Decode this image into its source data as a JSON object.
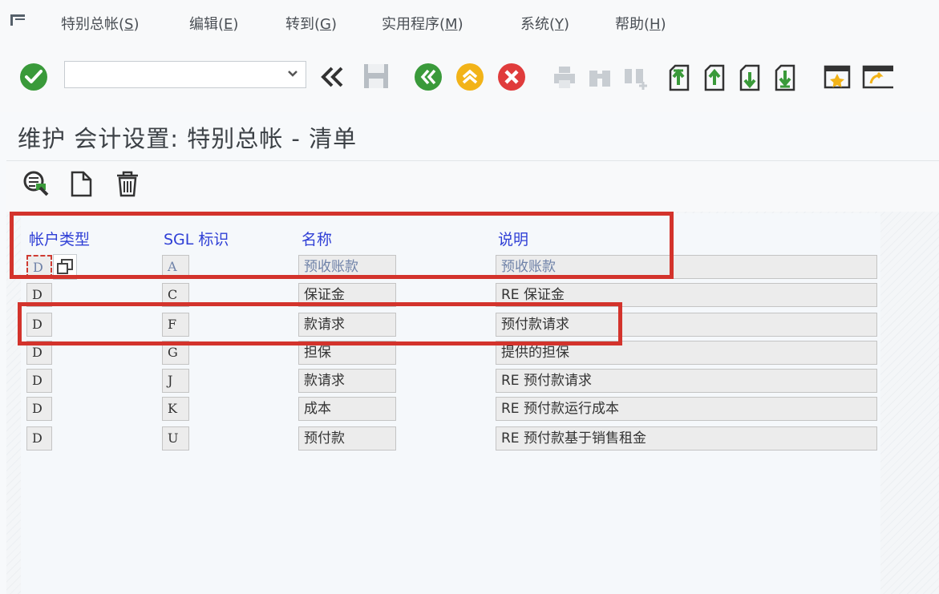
{
  "menu": {
    "items": [
      {
        "label": "特别总帐(",
        "key": "S",
        "tail": ")"
      },
      {
        "label": "编辑(",
        "key": "E",
        "tail": ")"
      },
      {
        "label": "转到(",
        "key": "G",
        "tail": ")"
      },
      {
        "label": "实用程序(",
        "key": "M",
        "tail": ")"
      },
      {
        "label": "系统(",
        "key": "Y",
        "tail": ")"
      },
      {
        "label": "帮助(",
        "key": "H",
        "tail": ")"
      }
    ]
  },
  "toolbar": {
    "command_value": ""
  },
  "title": "维护 会计设置: 特别总帐 - 清单",
  "table": {
    "headers": [
      "帐户类型",
      "SGL 标识",
      "名称",
      "说明"
    ],
    "rows": [
      {
        "account_type": "D",
        "sgl": "A",
        "name": "预收账款",
        "desc": "预收账款"
      },
      {
        "account_type": "D",
        "sgl": "C",
        "name": "保证金",
        "desc": "RE 保证金"
      },
      {
        "account_type": "D",
        "sgl": "F",
        "name": "款请求",
        "desc": "预付款请求"
      },
      {
        "account_type": "D",
        "sgl": "G",
        "name": "担保",
        "desc": "提供的担保"
      },
      {
        "account_type": "D",
        "sgl": "J",
        "name": "款请求",
        "desc": "RE 预付款请求"
      },
      {
        "account_type": "D",
        "sgl": "K",
        "name": "成本",
        "desc": "RE 预付款运行成本"
      },
      {
        "account_type": "D",
        "sgl": "U",
        "name": "预付款",
        "desc": "RE 预付款基于销售租金"
      }
    ]
  },
  "colors": {
    "header_text": "#2f3fd6",
    "highlight": "#d3332c",
    "ok_green": "#3a9a3a",
    "nav_yellow": "#f2b318",
    "cancel_red": "#e03c3c"
  }
}
